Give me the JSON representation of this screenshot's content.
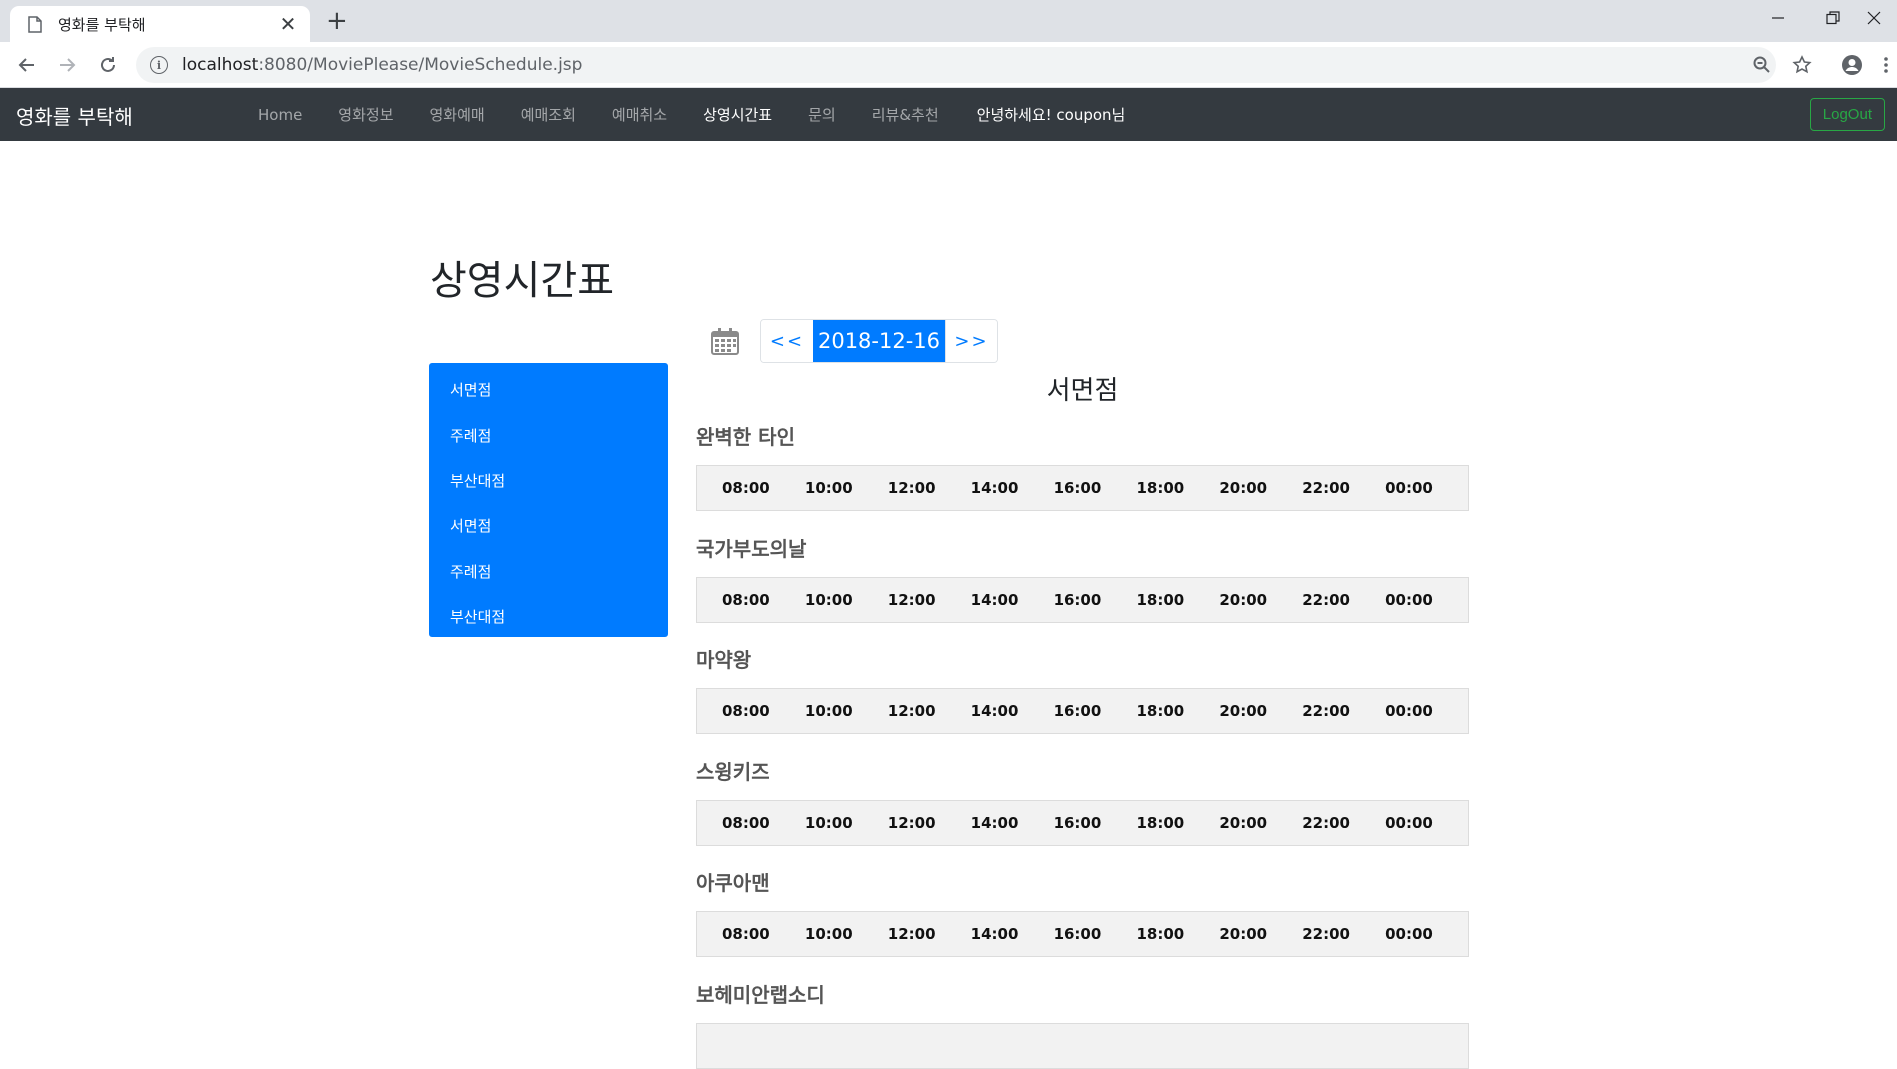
{
  "browser": {
    "tab_title": "영화를 부탁해",
    "url_host": "localhost",
    "url_rest": ":8080/MoviePlease/MovieSchedule.jsp"
  },
  "site": {
    "brand": "영화를 부탁해",
    "menu": [
      "Home",
      "영화정보",
      "영화예매",
      "예매조회",
      "예매취소",
      "상영시간표",
      "문의",
      "리뷰&추천"
    ],
    "active_menu_index": 5,
    "greeting": "안녕하세요! coupon님",
    "logout_label": "LogOut",
    "colors": {
      "navbar": "#343a40",
      "primary": "#007bff",
      "logout": "#28a745"
    }
  },
  "page": {
    "title": "상영시간표",
    "sidebar": [
      "서면점",
      "주례점",
      "부산대점",
      "서면점",
      "주례점",
      "부산대점"
    ],
    "date_prev": "<<",
    "date": "2018-12-16",
    "date_next": ">>",
    "theater": "서면점",
    "movies": [
      {
        "title": "완벽한 타인",
        "times": [
          "08:00",
          "10:00",
          "12:00",
          "14:00",
          "16:00",
          "18:00",
          "20:00",
          "22:00",
          "00:00"
        ]
      },
      {
        "title": "국가부도의날",
        "times": [
          "08:00",
          "10:00",
          "12:00",
          "14:00",
          "16:00",
          "18:00",
          "20:00",
          "22:00",
          "00:00"
        ]
      },
      {
        "title": "마약왕",
        "times": [
          "08:00",
          "10:00",
          "12:00",
          "14:00",
          "16:00",
          "18:00",
          "20:00",
          "22:00",
          "00:00"
        ]
      },
      {
        "title": "스윙키즈",
        "times": [
          "08:00",
          "10:00",
          "12:00",
          "14:00",
          "16:00",
          "18:00",
          "20:00",
          "22:00",
          "00:00"
        ]
      },
      {
        "title": "아쿠아맨",
        "times": [
          "08:00",
          "10:00",
          "12:00",
          "14:00",
          "16:00",
          "18:00",
          "20:00",
          "22:00",
          "00:00"
        ]
      },
      {
        "title": "보헤미안랩소디",
        "times": []
      }
    ]
  }
}
